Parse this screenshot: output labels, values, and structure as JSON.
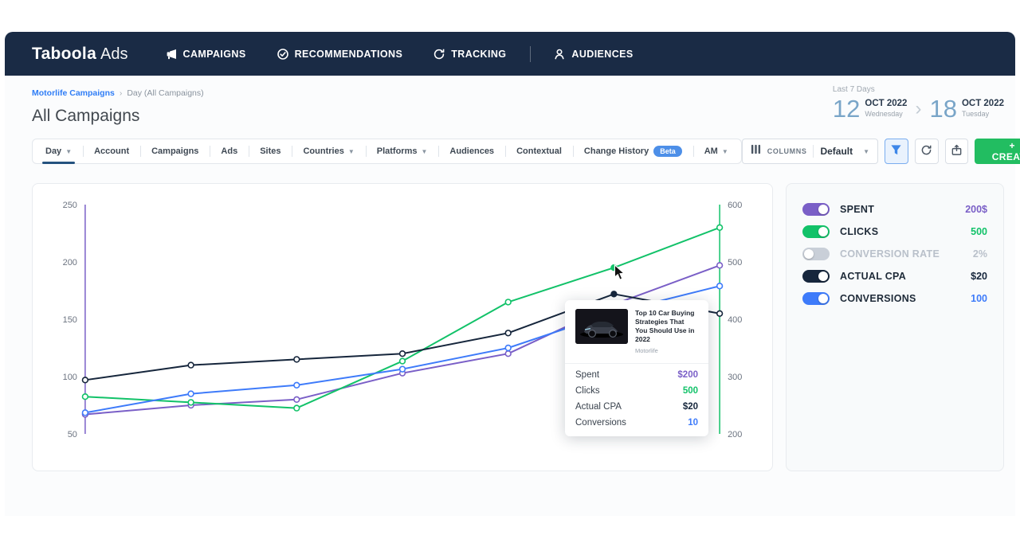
{
  "brand": {
    "logo_main": "Taboola",
    "logo_sub": "Ads"
  },
  "nav": {
    "items": [
      {
        "label": "CAMPAIGNS",
        "icon": "megaphone-icon"
      },
      {
        "label": "RECOMMENDATIONS",
        "icon": "check-circle-icon"
      },
      {
        "label": "TRACKING",
        "icon": "sync-icon"
      },
      {
        "label": "AUDIENCES",
        "icon": "person-icon"
      }
    ]
  },
  "breadcrumb": {
    "link": "Motorlife Campaigns",
    "separator": "›",
    "current": "Day (All Campaigns)"
  },
  "page": {
    "title": "All Campaigns"
  },
  "date_range": {
    "label": "Last 7 Days",
    "start_day": "12",
    "start_month": "OCT 2022",
    "start_weekday": "Wednesday",
    "chevron": "›",
    "end_day": "18",
    "end_month": "OCT 2022",
    "end_weekday": "Tuesday"
  },
  "toolbar": {
    "tabs": [
      {
        "label": "Day",
        "dropdown": true,
        "active": true
      },
      {
        "label": "Account"
      },
      {
        "label": "Campaigns"
      },
      {
        "label": "Ads"
      },
      {
        "label": "Sites"
      },
      {
        "label": "Countries",
        "dropdown": true
      },
      {
        "label": "Platforms",
        "dropdown": true
      },
      {
        "label": "Audiences"
      },
      {
        "label": "Contextual"
      },
      {
        "label": "Change History",
        "badge": "Beta"
      },
      {
        "label": "AM",
        "dropdown": true
      }
    ],
    "columns_label": "COLUMNS",
    "columns_value": "Default",
    "create_label": "+ CREATE",
    "accent_blue": "#3d86e8",
    "accent_green": "#22bd61"
  },
  "legend": {
    "items": [
      {
        "label": "SPENT",
        "value": "200$",
        "color": "#7a5fc7",
        "on": true
      },
      {
        "label": "CLICKS",
        "value": "500",
        "color": "#12c269",
        "on": true
      },
      {
        "label": "CONVERSION RATE",
        "value": "2%",
        "color": "#c9cfd8",
        "on": false
      },
      {
        "label": "ACTUAL CPA",
        "value": "$20",
        "color": "#16263c",
        "on": true
      },
      {
        "label": "CONVERSIONS",
        "value": "100",
        "color": "#3e7bfa",
        "on": true
      }
    ],
    "off_text_color": "#b9c0ca"
  },
  "tooltip": {
    "title": "Top 10 Car Buying Strategies That You Should Use in 2022",
    "source": "Motorlife",
    "rows": [
      {
        "label": "Spent",
        "value": "$200",
        "color": "#7a5fc7"
      },
      {
        "label": "Clicks",
        "value": "500",
        "color": "#12c269"
      },
      {
        "label": "Actual CPA",
        "value": "$20",
        "color": "#16263c"
      },
      {
        "label": "Conversions",
        "value": "10",
        "color": "#3e7bfa"
      }
    ]
  },
  "chart_data": {
    "type": "line",
    "x": [
      1,
      2,
      3,
      4,
      5,
      6,
      7
    ],
    "x_label": "",
    "grid": false,
    "left_axis": {
      "min": 50,
      "max": 250,
      "ticks": [
        250,
        200,
        150,
        100,
        50
      ],
      "color": "#7a5fc7"
    },
    "right_axis": {
      "min": 200,
      "max": 600,
      "ticks": [
        600,
        500,
        400,
        300,
        200
      ],
      "color": "#12c269"
    },
    "series": [
      {
        "name": "SPENT",
        "axis": "left",
        "color": "#7a5fc7",
        "values": [
          67,
          75,
          80,
          103,
          120,
          163,
          197
        ]
      },
      {
        "name": "CLICKS",
        "axis": "right",
        "color": "#12c269",
        "values": [
          265,
          255,
          245,
          327,
          430,
          490,
          560
        ]
      },
      {
        "name": "ACTUAL CPA",
        "axis": "left",
        "color": "#16263c",
        "values": [
          97,
          110,
          115,
          120,
          138,
          172,
          155
        ]
      },
      {
        "name": "CONVERSIONS",
        "axis": "right",
        "color": "#3e7bfa",
        "values": [
          237,
          270,
          285,
          313,
          350,
          412,
          458
        ]
      }
    ],
    "hover_index": 5
  }
}
